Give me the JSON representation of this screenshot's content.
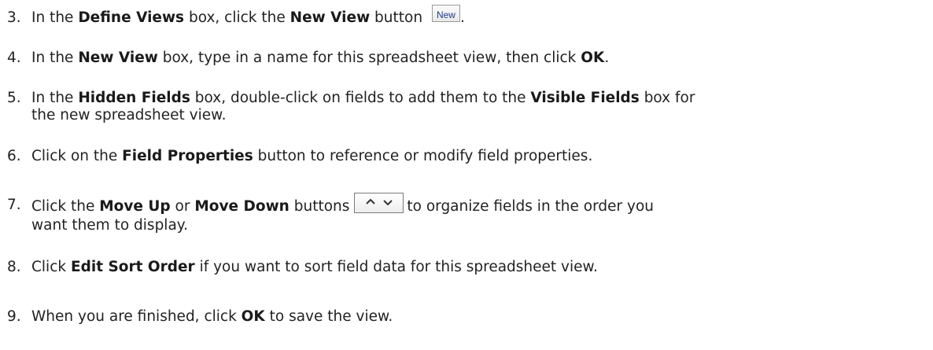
{
  "steps": [
    {
      "number": "3.",
      "t1": "In the ",
      "b1": "Define Views",
      "t2": " box, click the ",
      "b2": "New View",
      "t3": " button ",
      "button_label": "New",
      "t4": "."
    },
    {
      "number": "4.",
      "t1": "In the ",
      "b1": "New View",
      "t2": " box, type in a name for this spreadsheet view, then click ",
      "b2": "OK",
      "t3": "."
    },
    {
      "number": "5.",
      "t1": "In the ",
      "b1": "Hidden Fields",
      "t2": " box, double-click on fields to add them to the ",
      "b2": "Visible Fields",
      "t3": " box for",
      "line2": "the new spreadsheet view."
    },
    {
      "number": "6.",
      "t1": "Click on the ",
      "b1": "Field Properties",
      "t2": " button to reference or modify field properties."
    },
    {
      "number": "7.",
      "t1": "Click the ",
      "b1": "Move Up",
      "t2": " or ",
      "b2": "Move Down",
      "t3": " buttons",
      "t4": "to organize fields in the order you",
      "line2": "want them to display.",
      "icons": [
        "chevron-up-icon",
        "chevron-down-icon"
      ]
    },
    {
      "number": "8.",
      "t1": "Click ",
      "b1": "Edit Sort Order",
      "t2": " if you want to sort field data for this spreadsheet view."
    },
    {
      "number": "9.",
      "t1": "When you are finished, click ",
      "b1": "OK",
      "t2": " to save the view."
    }
  ]
}
